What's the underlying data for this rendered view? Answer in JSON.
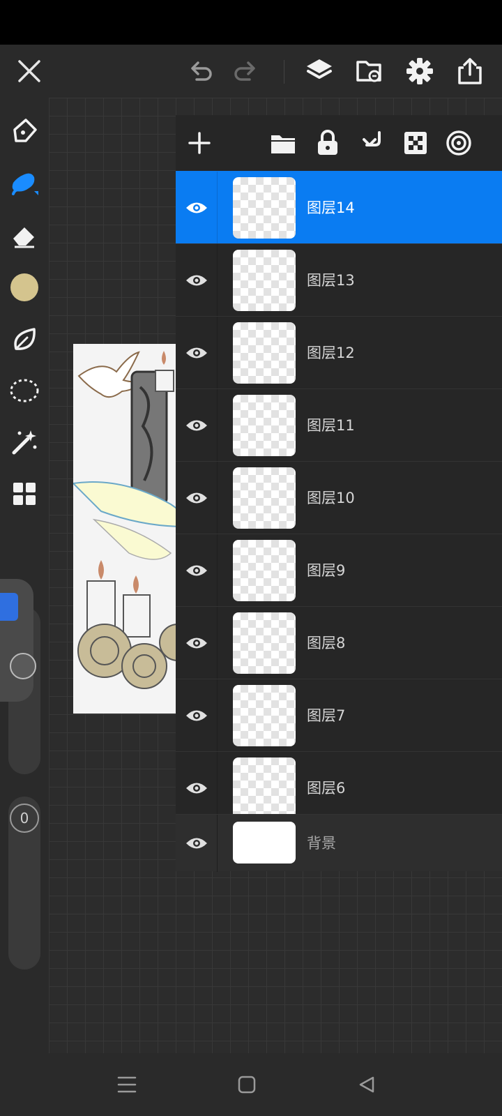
{
  "topbar": {
    "icons": [
      "close-icon",
      "undo-icon",
      "redo-icon",
      "layers-icon",
      "import-icon",
      "settings-icon",
      "share-icon"
    ]
  },
  "tools": [
    "pen-icon",
    "brush-icon",
    "eraser-icon",
    "color-swatch",
    "smudge-icon",
    "lasso-select-icon",
    "magic-wand-icon",
    "gallery-icon"
  ],
  "colors": {
    "accent": "#0a7cf2",
    "current_color": "#d4c48e"
  },
  "side_slider": {
    "opacity_value": "0"
  },
  "layers_panel": {
    "toolbar": [
      "add-layer-icon",
      "folder-icon",
      "lock-icon",
      "merge-down-icon",
      "alpha-lock-icon",
      "more-layer-options-icon"
    ],
    "layers": [
      {
        "name": "图层14",
        "visible": true,
        "selected": true
      },
      {
        "name": "图层13",
        "visible": true,
        "selected": false
      },
      {
        "name": "图层12",
        "visible": true,
        "selected": false
      },
      {
        "name": "图层11",
        "visible": true,
        "selected": false
      },
      {
        "name": "图层10",
        "visible": true,
        "selected": false
      },
      {
        "name": "图层9",
        "visible": true,
        "selected": false
      },
      {
        "name": "图层8",
        "visible": true,
        "selected": false
      },
      {
        "name": "图层7",
        "visible": true,
        "selected": false
      },
      {
        "name": "图层6",
        "visible": true,
        "selected": false
      }
    ],
    "background_layer": {
      "name": "背景",
      "visible": true
    }
  },
  "navbar": [
    "menu-icon",
    "home-icon",
    "back-icon"
  ]
}
